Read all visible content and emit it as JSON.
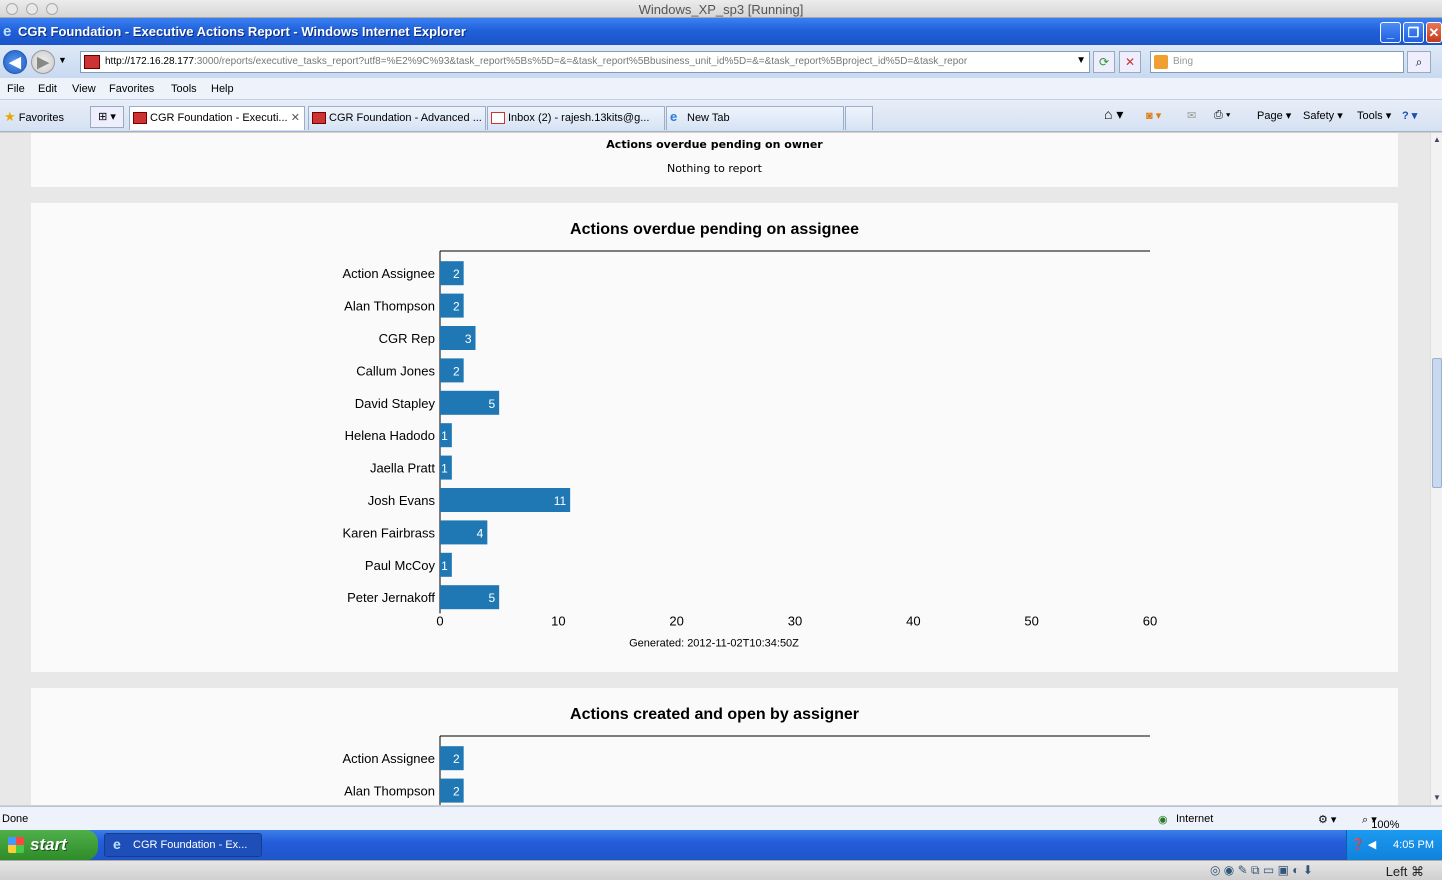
{
  "vm_title": "Windows_XP_sp3 [Running]",
  "window_title": "CGR Foundation - Executive Actions Report - Windows Internet Explorer",
  "address": {
    "host": "http://172.16.28.177",
    "rest": ":3000/reports/executive_tasks_report?utf8=%E2%9C%93&task_report%5Bs%5D=&=&task_report%5Bbusiness_unit_id%5D=&=&task_report%5Bproject_id%5D=&task_repor"
  },
  "search_placeholder": "Bing",
  "menu": [
    "File",
    "Edit",
    "View",
    "Favorites",
    "Tools",
    "Help"
  ],
  "favorites_label": "Favorites",
  "tabs": [
    {
      "label": "CGR Foundation - Executi...",
      "active": true
    },
    {
      "label": "CGR Foundation - Advanced ...",
      "active": false
    },
    {
      "label": "Inbox (2) - rajesh.13kits@g...",
      "active": false
    },
    {
      "label": "New Tab",
      "active": false
    }
  ],
  "commands": {
    "page": "Page",
    "safety": "Safety",
    "tools": "Tools"
  },
  "section_owner": {
    "title": "Actions overdue pending on owner",
    "message": "Nothing to report"
  },
  "chart_data": [
    {
      "type": "bar",
      "orientation": "horizontal",
      "title": "Actions overdue pending on assignee",
      "categories": [
        "Action Assignee",
        "Alan Thompson",
        "CGR Rep",
        "Callum Jones",
        "David Stapley",
        "Helena Hadodo",
        "Jaella Pratt",
        "Josh Evans",
        "Karen Fairbrass",
        "Paul McCoy",
        "Peter Jernakoff"
      ],
      "values": [
        2,
        2,
        3,
        2,
        5,
        1,
        1,
        11,
        4,
        1,
        5
      ],
      "xlim": [
        0,
        60
      ],
      "xticks": [
        0,
        10,
        20,
        30,
        40,
        50,
        60
      ],
      "bar_color": "#1f77b4",
      "footer": "Generated: 2012-11-02T10:34:50Z"
    },
    {
      "type": "bar",
      "orientation": "horizontal",
      "title": "Actions created and open by assigner",
      "categories": [
        "Action Assignee",
        "Alan Thompson"
      ],
      "values": [
        2,
        2
      ],
      "xlim": [
        0,
        60
      ],
      "bar_color": "#1f77b4"
    }
  ],
  "status": {
    "left": "Done",
    "zone": "Internet",
    "zoom": "100%"
  },
  "taskbar": {
    "start": "start",
    "item": "CGR Foundation - Ex...",
    "clock": "4:05 PM"
  },
  "mac_hint": "Left ⌘"
}
